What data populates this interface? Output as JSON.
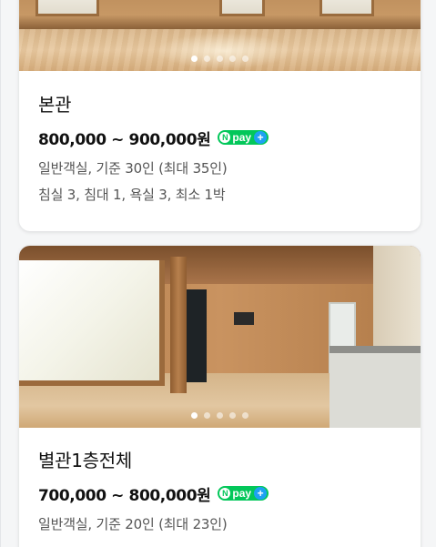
{
  "rooms": [
    {
      "name": "본관",
      "price": "800,000 ~ 900,000원",
      "npay_label": "pay",
      "npay_n": "N",
      "npay_plus": "+",
      "type_line": "일반객실, 기준 30인 (최대 35인)",
      "spec_line": "침실 3, 침대 1, 욕실 3, 최소 1박",
      "photo_count": 5,
      "photo_active_index": 0
    },
    {
      "name": "별관1층전체",
      "price": "700,000 ~ 800,000원",
      "npay_label": "pay",
      "npay_n": "N",
      "npay_plus": "+",
      "type_line": "일반객실, 기준 20인 (최대 23인)",
      "spec_line": "",
      "photo_count": 5,
      "photo_active_index": 0
    }
  ],
  "colors": {
    "npay_green": "#03c75a",
    "npay_plus_blue": "#1ea1f2",
    "page_background": "#f5f6f7"
  }
}
